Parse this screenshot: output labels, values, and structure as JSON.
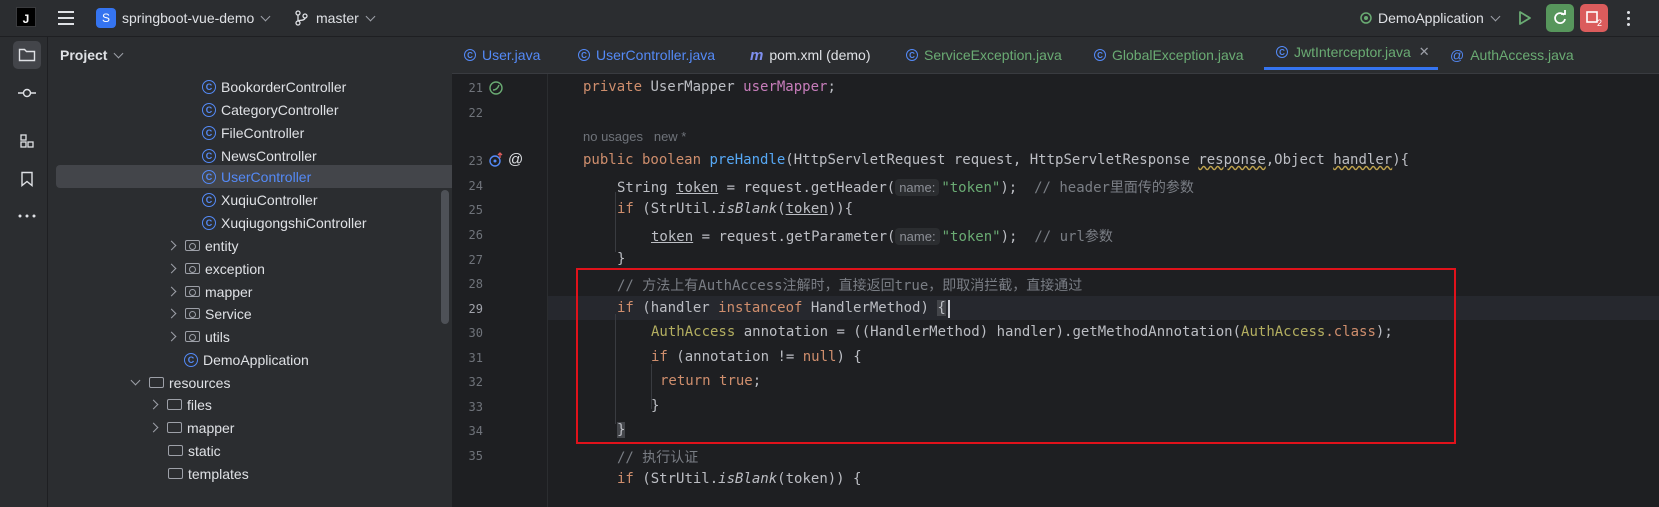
{
  "titlebar": {
    "project_initial": "S",
    "project_name": "springboot-vue-demo",
    "branch": "master",
    "run_config": "DemoApplication"
  },
  "toolstrip": [
    "project-icon",
    "commit-icon",
    "structure-icon",
    "bookmarks-icon",
    "more-icon"
  ],
  "project_panel": {
    "title": "Project",
    "rows": [
      {
        "label": "BookorderController",
        "type": "class"
      },
      {
        "label": "CategoryController",
        "type": "class"
      },
      {
        "label": "FileController",
        "type": "class"
      },
      {
        "label": "NewsController",
        "type": "class"
      },
      {
        "label": "UserController",
        "type": "class",
        "selected": true
      },
      {
        "label": "XuqiuController",
        "type": "class"
      },
      {
        "label": "XuqiugongshiController",
        "type": "class"
      },
      {
        "label": "entity",
        "type": "package"
      },
      {
        "label": "exception",
        "type": "package"
      },
      {
        "label": "mapper",
        "type": "package"
      },
      {
        "label": "Service",
        "type": "package"
      },
      {
        "label": "utils",
        "type": "package"
      },
      {
        "label": "DemoApplication",
        "type": "app"
      },
      {
        "label": "resources",
        "type": "folder-open"
      },
      {
        "label": "files",
        "type": "folder"
      },
      {
        "label": "mapper",
        "type": "folder"
      },
      {
        "label": "static",
        "type": "folder-leaf"
      },
      {
        "label": "templates",
        "type": "folder-leaf"
      }
    ]
  },
  "tabs": [
    {
      "label": "User.java"
    },
    {
      "label": "UserController.java"
    },
    {
      "label": "pom.xml (demo)"
    },
    {
      "label": "ServiceException.java"
    },
    {
      "label": "GlobalException.java"
    },
    {
      "label": "JwtInterceptor.java",
      "active": true
    },
    {
      "label": "AuthAccess.java"
    }
  ],
  "editor": {
    "line_numbers": [
      "21",
      "22",
      "23",
      "24",
      "25",
      "26",
      "27",
      "28",
      "29",
      "30",
      "31",
      "32",
      "33",
      "34",
      "35"
    ],
    "inlay_usages": "no usages",
    "inlay_new": "new *",
    "param_hint": "name:",
    "lines": {
      "l21_a": "private ",
      "l21_b": "UserMapper ",
      "l21_c": "userMapper",
      "l21_d": ";",
      "l23_a": "public boolean ",
      "l23_b": "preHandle",
      "l23_c": "(HttpServletRequest request, HttpServletResponse ",
      "l23_d": "response",
      "l23_e": ",Object ",
      "l23_f": "handler",
      "l23_g": "){",
      "l24_a": "String ",
      "l24_b": "token",
      "l24_c": " = request.getHeader(",
      "l24_d": "\"token\"",
      "l24_e": ");  ",
      "l24_f": "// header里面传的参数",
      "l25_a": "if ",
      "l25_b": "(StrUtil.",
      "l25_c": "isBlank",
      "l25_d": "(",
      "l25_e": "token",
      "l25_f": ")){",
      "l26_a": "token",
      "l26_b": " = request.getParameter(",
      "l26_c": "\"token\"",
      "l26_d": ");  ",
      "l26_e": "// url参数",
      "l27": "}",
      "l28": "// 方法上有AuthAccess注解时，直接返回true，即取消拦截，直接通过",
      "l29_a": "if ",
      "l29_b": "(handler ",
      "l29_c": "instanceof ",
      "l29_d": "HandlerMethod) ",
      "l29_e": "{",
      "l30_a": "AuthAccess",
      "l30_b": " annotation = ((HandlerMethod) handler).getMethodAnnotation(",
      "l30_c": "AuthAccess",
      "l30_d": ".class",
      "l30_e": ");",
      "l31_a": "if ",
      "l31_b": "(annotation != ",
      "l31_c": "null",
      "l31_d": ") {",
      "l32_a": "return ",
      "l32_b": "true",
      "l32_c": ";",
      "l33": "}",
      "l34": "}",
      "l35": "// 执行认证",
      "l36_a": "if ",
      "l36_b": "(StrUtil.",
      "l36_c": "isBlank",
      "l36_d": "(token)) {"
    }
  }
}
